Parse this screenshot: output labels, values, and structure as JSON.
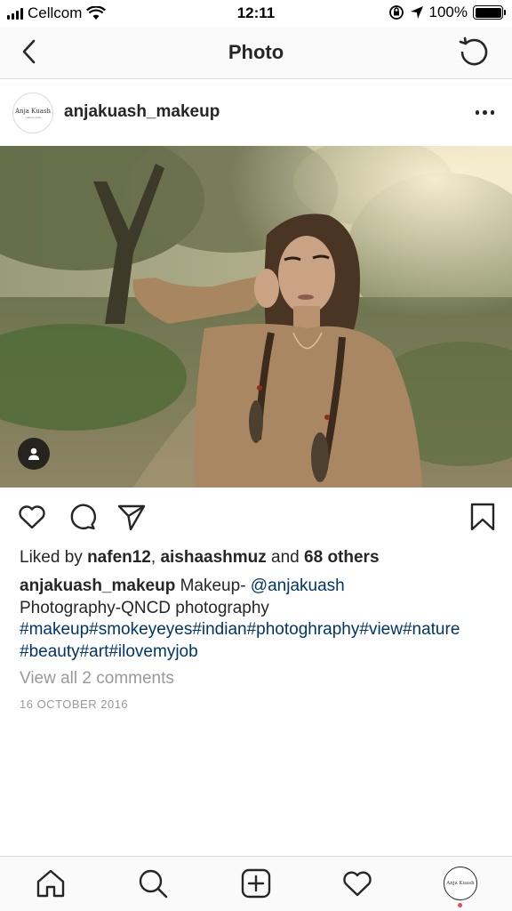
{
  "status_bar": {
    "carrier": "Cellcom",
    "time": "12:11",
    "battery": "100%",
    "icons": [
      "signal-icon",
      "wifi-icon",
      "orientation-lock-icon",
      "location-arrow-icon",
      "battery-icon"
    ]
  },
  "nav": {
    "title": "Photo",
    "back_icon": "chevron-left-icon",
    "refresh_icon": "refresh-icon"
  },
  "post": {
    "username": "anjakuash_makeup",
    "avatar_logo": "Anja Kuash",
    "avatar_tagline": "makeup artist",
    "more_icon": "more-dots-icon",
    "photo_icon": "tagged-people-icon"
  },
  "actions": {
    "icons": [
      "heart-icon",
      "comment-icon",
      "share-icon",
      "bookmark-icon"
    ]
  },
  "likes": {
    "prefix": "Liked by",
    "user1": "nafen12",
    "sep": ",",
    "user2": "aishaashmuz",
    "and": "and",
    "others": "68 others"
  },
  "caption": {
    "username": "anjakuash_makeup",
    "text1": "Makeup-",
    "mention": "@anjakuash",
    "text2": "Photography-QNCD photography",
    "hashtags_line1": "#makeup#smokeyeyes#indian#photoghraphy#view#nature",
    "hashtags_line2": "#beauty#art#ilovemyjob"
  },
  "comments_link": "View all 2 comments",
  "date": "16 OCTOBER 2016",
  "tabbar": {
    "icons": [
      "home-icon",
      "search-icon",
      "add-post-icon",
      "activity-heart-icon",
      "profile-avatar"
    ],
    "notification_color": "#ed4956"
  },
  "colors": {
    "text": "#262626",
    "link": "#003569",
    "muted": "#999999",
    "divider": "#dbdbdb"
  }
}
